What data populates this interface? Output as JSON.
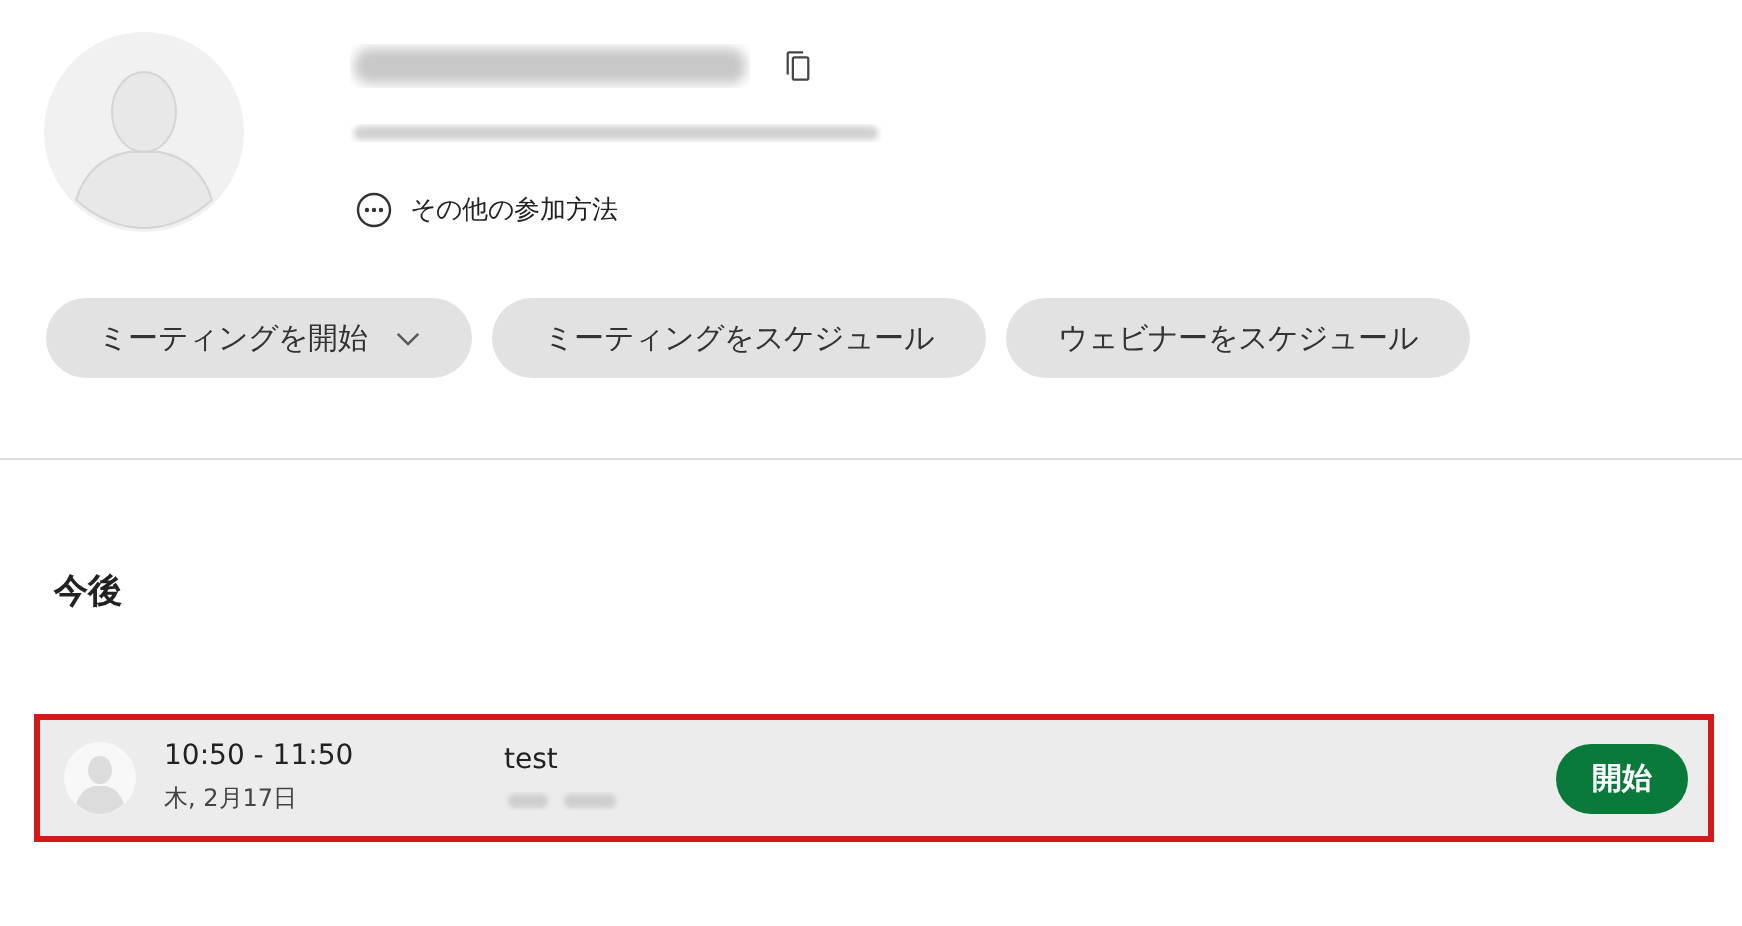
{
  "profile": {
    "other_join_methods": "その他の参加方法"
  },
  "actions": [
    {
      "label": "ミーティングを開始",
      "has_dropdown": true
    },
    {
      "label": "ミーティングをスケジュール",
      "has_dropdown": false
    },
    {
      "label": "ウェビナーをスケジュール",
      "has_dropdown": false
    }
  ],
  "upcoming": {
    "heading": "今後",
    "meetings": [
      {
        "time": "10:50 - 11:50",
        "date": "木, 2月17日",
        "title": "test",
        "highlighted": true,
        "button": "開始"
      }
    ]
  }
}
